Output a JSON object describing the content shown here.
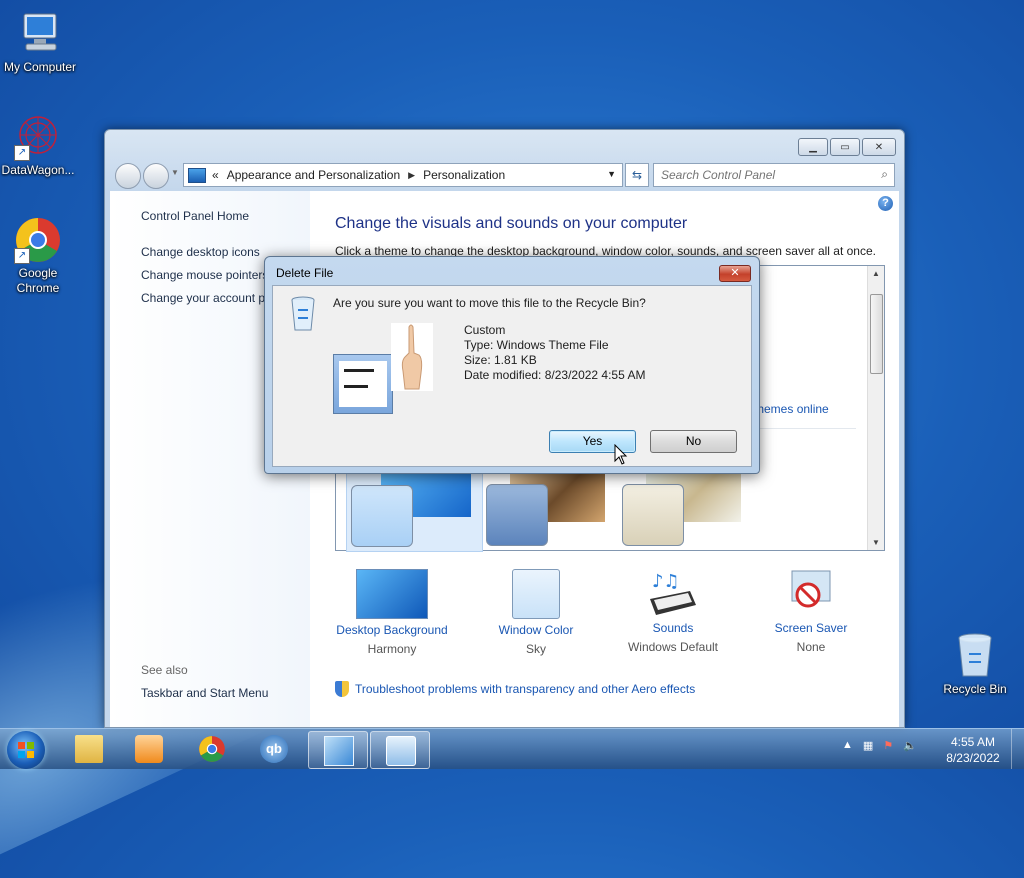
{
  "desktop": {
    "icons": [
      {
        "label": "My Computer"
      },
      {
        "label": "DataWagon..."
      },
      {
        "label": "Google Chrome"
      },
      {
        "label": "Recycle Bin"
      }
    ]
  },
  "window": {
    "address": {
      "prefix": "«",
      "crumb1": "Appearance and Personalization",
      "crumb2": "Personalization"
    },
    "search_placeholder": "Search Control Panel",
    "left_pane": {
      "links": [
        "Control Panel Home",
        "Change desktop icons",
        "Change mouse pointers",
        "Change your account p"
      ],
      "see_also": "See also",
      "see_also_links": [
        "Taskbar and Start Menu"
      ]
    },
    "heading": "Change the visuals and sounds on your computer",
    "subtext": "Click a theme to change the desktop background, window color, sounds, and screen saver all at once.",
    "get_more": "re themes online",
    "bottom_items": [
      {
        "title": "Desktop Background",
        "sub": "Harmony"
      },
      {
        "title": "Window Color",
        "sub": "Sky"
      },
      {
        "title": "Sounds",
        "sub": "Windows Default"
      },
      {
        "title": "Screen Saver",
        "sub": "None"
      }
    ],
    "troubleshoot": "Troubleshoot problems with transparency and other Aero effects"
  },
  "dialog": {
    "title": "Delete File",
    "question": "Are you sure you want to move this file to the Recycle Bin?",
    "file": {
      "name": "Custom",
      "type": "Type: Windows Theme File",
      "size": "Size: 1.81 KB",
      "modified": "Date modified: 8/23/2022 4:55 AM"
    },
    "yes_label": "Yes",
    "no_label": "No"
  },
  "taskbar": {
    "time": "4:55 AM",
    "date": "8/23/2022"
  },
  "colors": {
    "link": "#1a57b3",
    "heading": "#1e3287",
    "desktop": "#1a5fb8"
  }
}
